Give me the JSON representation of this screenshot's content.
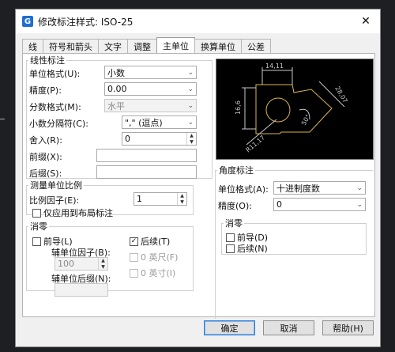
{
  "window": {
    "title": "修改标注样式: ISO-25",
    "app_icon": "G",
    "close_glyph": "✕"
  },
  "tabs": [
    {
      "label": "线",
      "active": false
    },
    {
      "label": "符号和箭头",
      "active": false
    },
    {
      "label": "文字",
      "active": false
    },
    {
      "label": "调整",
      "active": false
    },
    {
      "label": "主单位",
      "active": true
    },
    {
      "label": "换算单位",
      "active": false
    },
    {
      "label": "公差",
      "active": false
    }
  ],
  "linear": {
    "legend": "线性标注",
    "unit_format_label": "单位格式(U):",
    "unit_format_value": "小数",
    "precision_label": "精度(P):",
    "precision_value": "0.00",
    "fraction_label": "分数格式(M):",
    "fraction_value": "水平",
    "decimal_sep_label": "小数分隔符(C):",
    "decimal_sep_value": "\",\" (逗点)",
    "round_label": "舍入(R):",
    "round_value": "0",
    "prefix_label": "前缀(X):",
    "prefix_value": "",
    "suffix_label": "后缀(S):",
    "suffix_value": ""
  },
  "scale": {
    "legend": "测量单位比例",
    "factor_label": "比例因子(E):",
    "factor_value": "1",
    "layout_only_label": "仅应用到布局标注",
    "layout_only_checked": false
  },
  "zero_linear": {
    "legend": "消零",
    "leading_label": "前导(L)",
    "leading_checked": false,
    "trailing_label": "后续(T)",
    "trailing_checked": true,
    "sub_factor_label": "辅单位因子(B):",
    "sub_factor_value": "100",
    "sub_suffix_label": "辅单位后缀(N):",
    "sub_suffix_value": "",
    "feet_label": "0 英尺(F)",
    "inch_label": "0 英寸(I)"
  },
  "angular": {
    "legend": "角度标注",
    "unit_format_label": "单位格式(A):",
    "unit_format_value": "十进制度数",
    "precision_label": "精度(O):",
    "precision_value": "0"
  },
  "zero_angular": {
    "legend": "消零",
    "leading_label": "前导(D)",
    "leading_checked": false,
    "trailing_label": "后续(N)",
    "trailing_checked": false
  },
  "preview": {
    "dim_top": "14,11",
    "dim_left": "16,6",
    "dim_right": "28,07",
    "dim_angle": "50°",
    "dim_radius": "R11,17",
    "line_color": "#c9c9c9",
    "shape_color": "#d9b64a"
  },
  "buttons": {
    "ok": "确定",
    "cancel": "取消",
    "help": "帮助(H)"
  },
  "glyphs": {
    "dropdown": "⌄",
    "check": "✓",
    "spin_up": "▲",
    "spin_down": "▼"
  }
}
